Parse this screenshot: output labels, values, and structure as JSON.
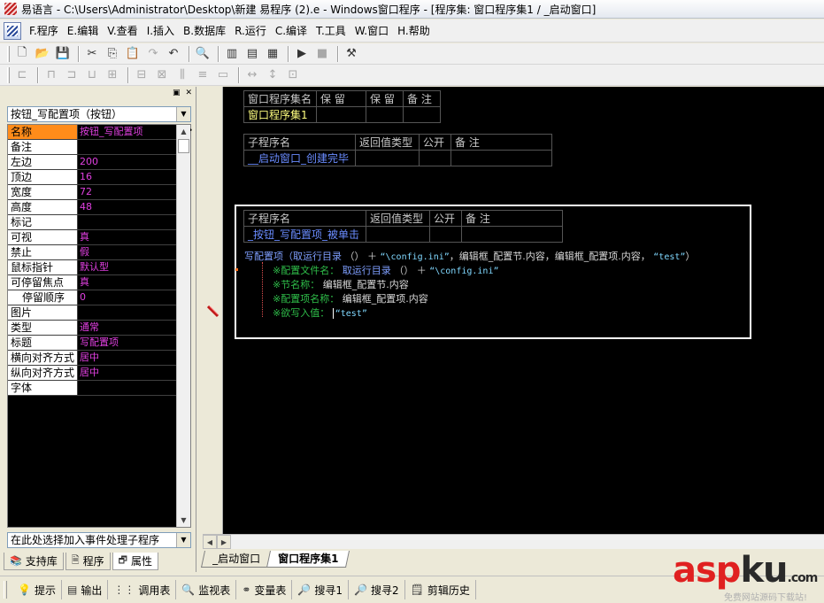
{
  "window": {
    "title": "易语言 - C:\\Users\\Administrator\\Desktop\\新建 易程序 (2).e - Windows窗口程序 - [程序集: 窗口程序集1 / _启动窗口]"
  },
  "menu": [
    "F.程序",
    "E.编辑",
    "V.查看",
    "I.插入",
    "B.数据库",
    "R.运行",
    "C.编译",
    "T.工具",
    "W.窗口",
    "H.帮助"
  ],
  "toolbar_icons": [
    "new-icon",
    "open-icon",
    "save-icon",
    "cut-icon",
    "copy-icon",
    "paste-icon",
    "redo-icon",
    "undo-icon",
    "find-icon",
    "layout-icon",
    "layout2-icon",
    "layout3-icon",
    "run-icon",
    "stop-icon",
    "compile-icon"
  ],
  "left_panel": {
    "component_selector": "按钮_写配置项（按钮）",
    "properties": [
      {
        "name": "名称",
        "value": "按钮_写配置项"
      },
      {
        "name": "备注",
        "value": ""
      },
      {
        "name": "左边",
        "value": "200"
      },
      {
        "name": "顶边",
        "value": "16"
      },
      {
        "name": "宽度",
        "value": "72"
      },
      {
        "name": "高度",
        "value": "48"
      },
      {
        "name": "标记",
        "value": ""
      },
      {
        "name": "可视",
        "value": "真"
      },
      {
        "name": "禁止",
        "value": "假"
      },
      {
        "name": "鼠标指针",
        "value": "默认型"
      },
      {
        "name": "可停留焦点",
        "value": "真"
      },
      {
        "name": "停留顺序",
        "value": "0"
      },
      {
        "name": "图片",
        "value": ""
      },
      {
        "name": "类型",
        "value": "通常"
      },
      {
        "name": "标题",
        "value": "写配置项"
      },
      {
        "name": "横向对齐方式",
        "value": "居中"
      },
      {
        "name": "纵向对齐方式",
        "value": "居中"
      },
      {
        "name": "字体",
        "value": ""
      }
    ],
    "event_selector": "在此处选择加入事件处理子程序",
    "tabs": [
      "支持库",
      "程序",
      "属性"
    ]
  },
  "editor": {
    "assembly_table": {
      "headers": [
        "窗口程序集名",
        "保 留",
        "保 留",
        "备 注"
      ],
      "row": [
        "窗口程序集1",
        "",
        "",
        ""
      ]
    },
    "sub1": {
      "headers": [
        "子程序名",
        "返回值类型",
        "公开",
        "备 注"
      ],
      "row": [
        "__启动窗口_创建完毕",
        "",
        "",
        ""
      ]
    },
    "sub2": {
      "headers": [
        "子程序名",
        "返回值类型",
        "公开",
        "备 注"
      ],
      "row": [
        "_按钮_写配置项_被单击",
        "",
        "",
        ""
      ]
    },
    "code": {
      "call": "写配置项",
      "arg_open": "（取运行目录",
      "concat": "（） ＋",
      "file_str": "“\\config.ini”",
      "section": "，编辑框_配置节.内容，编辑框_配置项.内容，",
      "value_str": "“test”",
      "close": "）",
      "hint1_label": "※配置文件名：",
      "hint1_fn": "取运行目录",
      "hint1_rest": "（） ＋",
      "hint1_str": "“\\config.ini”",
      "hint2_label": "※节名称：",
      "hint2_val": "编辑框_配置节.内容",
      "hint3_label": "※配置项名称：",
      "hint3_val": "编辑框_配置项.内容",
      "hint4_label": "※欲写入值：",
      "hint4_val": "“test”"
    }
  },
  "file_tabs": [
    "_启动窗口",
    "窗口程序集1"
  ],
  "status_tabs": [
    {
      "icon": "hint-icon",
      "label": "提示"
    },
    {
      "icon": "output-icon",
      "label": "输出"
    },
    {
      "icon": "calltable-icon",
      "label": "调用表"
    },
    {
      "icon": "watch-icon",
      "label": "监视表"
    },
    {
      "icon": "variables-icon",
      "label": "变量表"
    },
    {
      "icon": "search1-icon",
      "label": "搜寻1"
    },
    {
      "icon": "search2-icon",
      "label": "搜寻2"
    },
    {
      "icon": "history-icon",
      "label": "剪辑历史"
    }
  ],
  "watermark": {
    "brand_a": "asp",
    "brand_b": "ku",
    "suffix": ".com",
    "sub": "免费网站源码下载站!"
  }
}
